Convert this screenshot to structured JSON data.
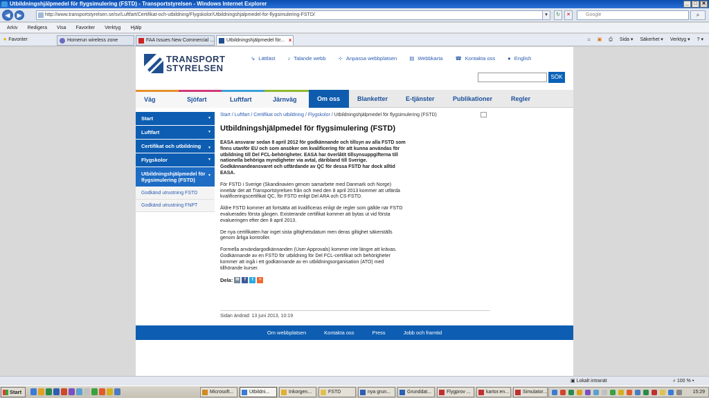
{
  "window": {
    "title": "Utbildningshjälpmedel för flygsimulering (FSTD) - Transportstyrelsen - Windows Internet Explorer",
    "minimize": "_",
    "maximize": "□",
    "close": "✕"
  },
  "addressbar": {
    "url": "http://www.transportstyrelsen.se/sv/Luftfart/Certifikat-och-utbildning/Flygskolor/Utbildningshjalpmedel-for-flygsimulering-FSTD/",
    "search_placeholder": "Google",
    "back": "◀",
    "forward": "▶",
    "refresh": "↻",
    "stop": "✕",
    "search_go": "⌕"
  },
  "menubar": [
    "Arkiv",
    "Redigera",
    "Visa",
    "Favoriter",
    "Verktyg",
    "Hjälp"
  ],
  "favbar": {
    "favorites_label": "Favoriter",
    "tabs": [
      {
        "label": "Homerun wireless zone"
      },
      {
        "label": "FAA Issues New Commercial ..."
      },
      {
        "label": "Utbildningshjälpmedel för..."
      }
    ],
    "tab_close": "x",
    "commands": [
      "Sida ▾",
      "Säkerhet ▾",
      "Verktyg ▾",
      "? ▾"
    ]
  },
  "site": {
    "logo_line1": "TRANSPORT",
    "logo_line2": "STYRELSEN",
    "toplinks": [
      "Lättläst",
      "Talande webb",
      "Anpassa webbplatsen",
      "Webbkarta",
      "Kontakta oss",
      "English"
    ],
    "search_button": "SÖK",
    "mainnav": [
      "Väg",
      "Sjöfart",
      "Luftfart",
      "Järnväg",
      "Om oss",
      "Blanketter",
      "E-tjänster",
      "Publikationer",
      "Regler"
    ],
    "mainnav_colors": [
      "#e8902a",
      "#d2387a",
      "#3aa0d8",
      "#8fb82f"
    ],
    "sidebar": [
      "Start",
      "Luftfart",
      "Certifikat och utbildning",
      "Flygskolor",
      "Utbildningshjälpmedel för flygsimulering (FSTD)"
    ],
    "subitems": [
      "Godkänd utrustning FSTD",
      "Godkänd utrustning FNPT"
    ],
    "breadcrumbs": [
      "Start",
      "Luftfart",
      "Certifikat och utbildning",
      "Flygskolor"
    ],
    "breadcrumb_current": "Utbildningshjälpmedel för flygsimulering (FSTD)",
    "breadcrumb_sep": " / ",
    "heading": "Utbildningshjälpmedel för flygsimulering (FSTD)",
    "lead": "EASA ansvarar sedan 8 april 2012 för godkännande och tillsyn av alla FSTD som finns utanför EU och som ansöker om kvalificering för att kunna användas för utbildning till Del FCL-behörigheter. EASA har överlåtit tillsynsuppgifterna till nationella behöriga myndigheter via avtal, däribland till Sverige. Godkännandeansvaret och utfärdande av QC för dessa FSTD har dock alltid EASA.",
    "paragraphs": [
      "För FSTD i Sverige (Skandinavien genom samarbete med Danmark och Norge) innebär det att Transportstyrelsen från och med den 8 april 2013 kommer att utfärda kvalificeringscertifikat QC, för FSTD enligt Del ARA och CS-FSTD.",
      "Äldre FSTD kommer att fortsätta att kvalificeras enligt de regler som gällde när FSTD evaluerades första gången. Existerande certifikat kommer att bytas ut vid första evalueringen efter den 8 april 2013.",
      "De nya certifikaten har inget sista giltighetsdatum men deras giltighet säkerställs genom årliga kontroller.",
      "Formella användargodkännanden (User Approvals) kommer inte längre att krävas. Godkännande av en FSTD för utbildning för Del FCL-certifikat och behörigheter kommer att ingå i ett godkännande av en utbildningsorganisation (ATO) med tillhörande kurser."
    ],
    "share_label": "Dela:",
    "changed": "Sidan ändrad: 13 juni 2013, 10:19",
    "footer": [
      "Om webbplatsen",
      "Kontakta oss",
      "Press",
      "Jobb och framtid"
    ]
  },
  "statusbar": {
    "zone": "Lokalt intranät",
    "zoom": "100 %"
  },
  "taskbar": {
    "start": "Start",
    "tasks": [
      "Microsoft...",
      "Utbildni...",
      "Inkorgen...",
      "FSTD",
      "nya grun...",
      "Grunddat...",
      "Flygprov ...",
      "kartor.en...",
      "Simulator..."
    ],
    "clock": "15:29"
  }
}
